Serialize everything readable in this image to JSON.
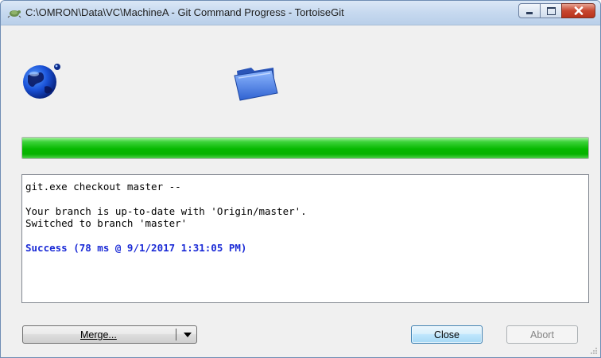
{
  "window": {
    "title": "C:\\OMRON\\Data\\VC\\MachineA - Git Command Progress - TortoiseGit",
    "app_icon": "tortoisegit-icon",
    "controls": [
      "minimize-icon",
      "maximize-icon",
      "close-icon"
    ]
  },
  "animation": {
    "left_icon": "globe-icon",
    "right_icon": "folder-icon"
  },
  "progress": {
    "fraction": 1.0,
    "color": "#06b800"
  },
  "log": {
    "lines": [
      "git.exe checkout master --",
      "",
      "Your branch is up-to-date with 'Origin/master'.",
      "Switched to branch 'master'",
      "",
      "Success (78 ms @ 9/1/2017 1:31:05 PM)"
    ],
    "success_color": "#1b2bd6"
  },
  "buttons": {
    "merge_label": "Merge...",
    "close_label": "Close",
    "abort_label": "Abort"
  }
}
